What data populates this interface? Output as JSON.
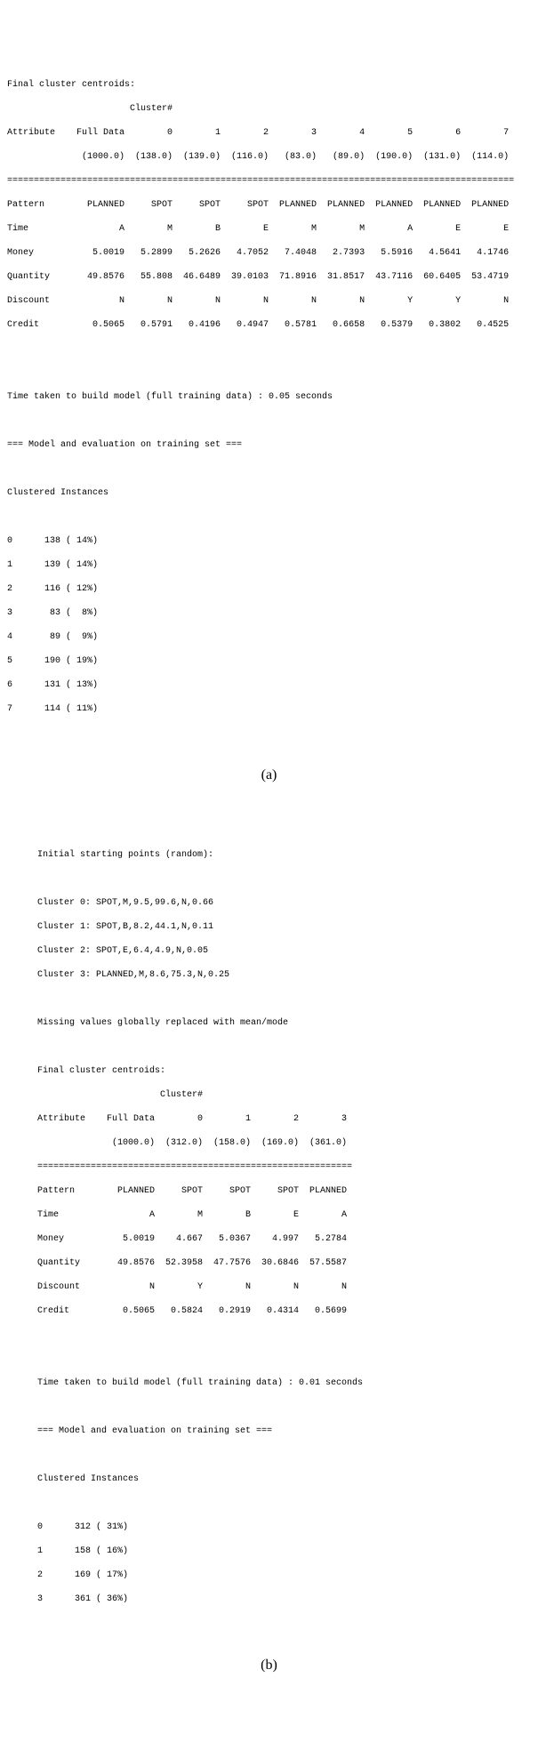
{
  "a": {
    "title": "Final cluster centroids:",
    "header_cluster": "                       Cluster#",
    "header1": "Attribute    Full Data        0        1        2        3        4        5        6        7",
    "header2": "              (1000.0)  (138.0)  (139.0)  (116.0)   (83.0)   (89.0)  (190.0)  (131.0)  (114.0)",
    "sep": "===============================================================================================",
    "rows": [
      "Pattern        PLANNED     SPOT     SPOT     SPOT  PLANNED  PLANNED  PLANNED  PLANNED  PLANNED",
      "Time                 A        M        B        E        M        M        A        E        E",
      "Money           5.0019   5.2899   5.2626   4.7052   7.4048   2.7393   5.5916   4.5641   4.1746",
      "Quantity       49.8576   55.808  46.6489  39.0103  71.8916  31.8517  43.7116  60.6405  53.4719",
      "Discount             N        N        N        N        N        N        Y        Y        N",
      "Credit          0.5065   0.5791   0.4196   0.4947   0.5781   0.6658   0.5379   0.3802   0.4525"
    ],
    "build_time": "Time taken to build model (full training data) : 0.05 seconds",
    "eval": "=== Model and evaluation on training set ===",
    "ci_title": "Clustered Instances",
    "ci": [
      "0      138 ( 14%)",
      "1      139 ( 14%)",
      "2      116 ( 12%)",
      "3       83 (  8%)",
      "4       89 (  9%)",
      "5      190 ( 19%)",
      "6      131 ( 13%)",
      "7      114 ( 11%)"
    ],
    "caption": "(a)"
  },
  "b": {
    "init_title": "Initial starting points (random):",
    "init": [
      "Cluster 0: SPOT,M,9.5,99.6,N,0.66",
      "Cluster 1: SPOT,B,8.2,44.1,N,0.11",
      "Cluster 2: SPOT,E,6.4,4.9,N,0.05",
      "Cluster 3: PLANNED,M,8.6,75.3,N,0.25"
    ],
    "missing": "Missing values globally replaced with mean/mode",
    "title": "Final cluster centroids:",
    "header_cluster": "                       Cluster#",
    "header1": "Attribute    Full Data        0        1        2        3",
    "header2": "              (1000.0)  (312.0)  (158.0)  (169.0)  (361.0)",
    "sep": "===========================================================",
    "rows": [
      "Pattern        PLANNED     SPOT     SPOT     SPOT  PLANNED",
      "Time                 A        M        B        E        A",
      "Money           5.0019    4.667   5.0367    4.997   5.2784",
      "Quantity       49.8576  52.3958  47.7576  30.6846  57.5587",
      "Discount             N        Y        N        N        N",
      "Credit          0.5065   0.5824   0.2919   0.4314   0.5699"
    ],
    "build_time": "Time taken to build model (full training data) : 0.01 seconds",
    "eval": "=== Model and evaluation on training set ===",
    "ci_title": "Clustered Instances",
    "ci": [
      "0      312 ( 31%)",
      "1      158 ( 16%)",
      "2      169 ( 17%)",
      "3      361 ( 36%)"
    ],
    "caption": "(b)"
  }
}
